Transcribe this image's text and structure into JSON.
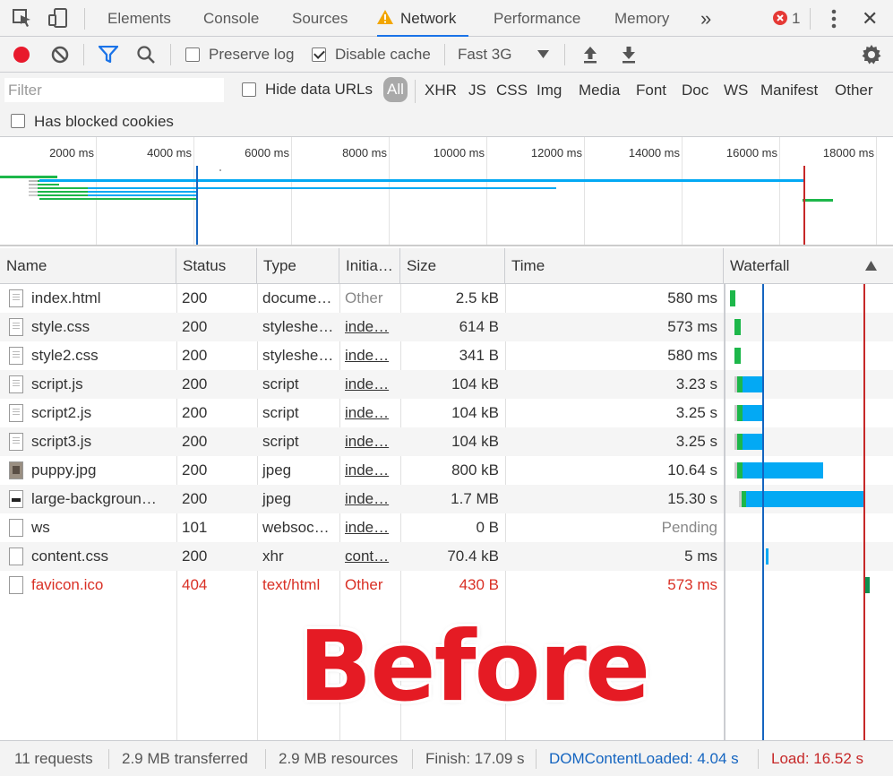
{
  "tabs": {
    "elements": "Elements",
    "console": "Console",
    "sources": "Sources",
    "network": "Network",
    "performance": "Performance",
    "memory": "Memory",
    "more": "»",
    "error_count": "1",
    "close": "✕"
  },
  "toolbar": {
    "preserve_log": "Preserve log",
    "disable_cache": "Disable cache",
    "disable_cache_checked": true,
    "preserve_log_checked": false,
    "throttle": "Fast 3G"
  },
  "filter": {
    "placeholder": "Filter",
    "hide_data_urls": "Hide data URLs",
    "types": [
      "All",
      "XHR",
      "JS",
      "CSS",
      "Img",
      "Media",
      "Font",
      "Doc",
      "WS",
      "Manifest",
      "Other"
    ],
    "active_type": "All",
    "has_blocked_cookies": "Has blocked cookies"
  },
  "overview": {
    "ticks": [
      "2000 ms",
      "4000 ms",
      "6000 ms",
      "8000 ms",
      "10000 ms",
      "12000 ms",
      "14000 ms",
      "16000 ms",
      "18000 ms"
    ]
  },
  "table": {
    "headers": {
      "name": "Name",
      "status": "Status",
      "type": "Type",
      "initiator": "Initia…",
      "size": "Size",
      "time": "Time",
      "waterfall": "Waterfall"
    },
    "rows": [
      {
        "name": "index.html",
        "status": "200",
        "type": "docume…",
        "initiator": "Other",
        "size": "2.5 kB",
        "time": "580 ms",
        "icon": "doc"
      },
      {
        "name": "style.css",
        "status": "200",
        "type": "styleshe…",
        "initiator": "inde…",
        "size": "614 B",
        "time": "573 ms",
        "icon": "doc"
      },
      {
        "name": "style2.css",
        "status": "200",
        "type": "styleshe…",
        "initiator": "inde…",
        "size": "341 B",
        "time": "580 ms",
        "icon": "doc"
      },
      {
        "name": "script.js",
        "status": "200",
        "type": "script",
        "initiator": "inde…",
        "size": "104 kB",
        "time": "3.23 s",
        "icon": "doc"
      },
      {
        "name": "script2.js",
        "status": "200",
        "type": "script",
        "initiator": "inde…",
        "size": "104 kB",
        "time": "3.25 s",
        "icon": "doc"
      },
      {
        "name": "script3.js",
        "status": "200",
        "type": "script",
        "initiator": "inde…",
        "size": "104 kB",
        "time": "3.25 s",
        "icon": "doc"
      },
      {
        "name": "puppy.jpg",
        "status": "200",
        "type": "jpeg",
        "initiator": "inde…",
        "size": "800 kB",
        "time": "10.64 s",
        "icon": "img"
      },
      {
        "name": "large-backgroun…",
        "status": "200",
        "type": "jpeg",
        "initiator": "inde…",
        "size": "1.7 MB",
        "time": "15.30 s",
        "icon": "dark"
      },
      {
        "name": "ws",
        "status": "101",
        "type": "websoc…",
        "initiator": "inde…",
        "size": "0 B",
        "time": "Pending",
        "icon": "blank"
      },
      {
        "name": "content.css",
        "status": "200",
        "type": "xhr",
        "initiator": "cont…",
        "size": "70.4 kB",
        "time": "5 ms",
        "icon": "blank"
      },
      {
        "name": "favicon.ico",
        "status": "404",
        "type": "text/html",
        "initiator": "Other",
        "size": "430 B",
        "time": "573 ms",
        "icon": "blank"
      }
    ]
  },
  "overlay": {
    "text": "Before"
  },
  "status": {
    "requests": "11 requests",
    "transferred": "2.9 MB transferred",
    "resources": "2.9 MB resources",
    "finish": "Finish: 17.09 s",
    "dom_content_loaded": "DOMContentLoaded: 4.04 s",
    "load": "Load: 16.52 s"
  },
  "colors": {
    "accent": "#1a73e8",
    "record_red": "#e8192c",
    "waiting_green": "#1db74a",
    "download_blue": "#03a9f4",
    "dcl_blue": "#1565c0",
    "load_red": "#c62828",
    "error_red": "#d93025"
  }
}
